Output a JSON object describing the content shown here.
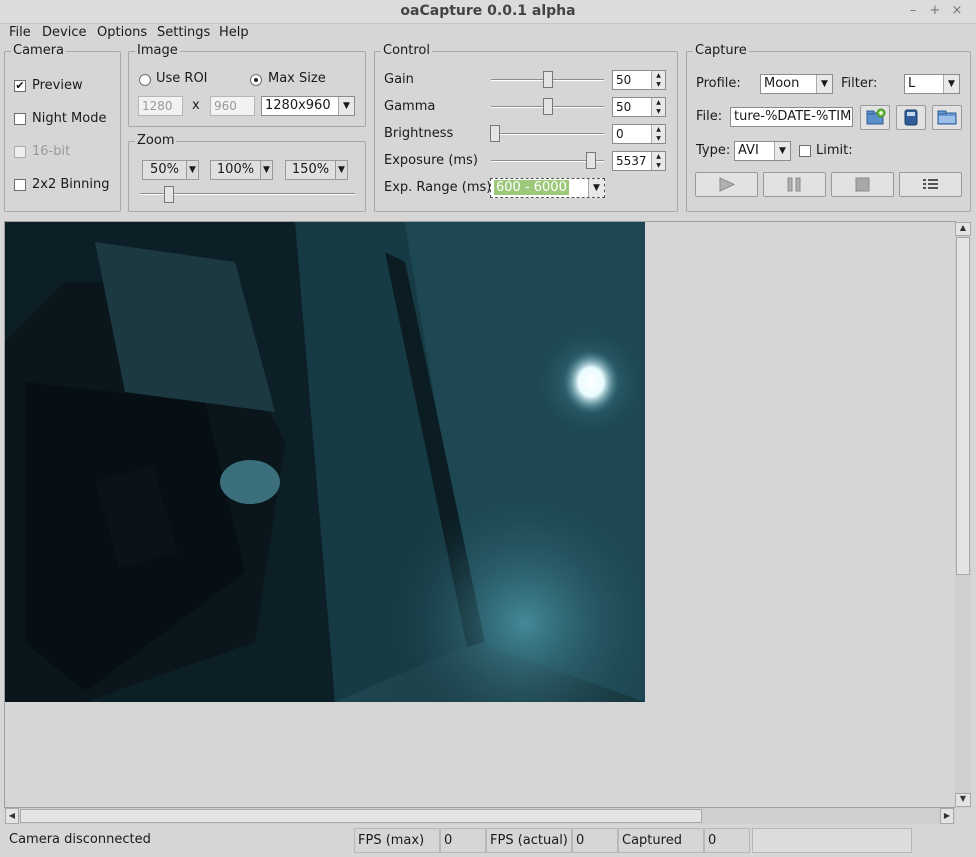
{
  "window": {
    "title": "oaCapture 0.0.1 alpha",
    "min": "–",
    "max": "+",
    "close": "×"
  },
  "menu": [
    "File",
    "Device",
    "Options",
    "Settings",
    "Help"
  ],
  "camera": {
    "title": "Camera",
    "preview": {
      "label": "Preview",
      "checked": true
    },
    "night_mode": {
      "label": "Night Mode",
      "checked": false
    },
    "bit16": {
      "label": "16-bit",
      "checked": false,
      "disabled": true
    },
    "binning": {
      "label": "2x2 Binning",
      "checked": false
    }
  },
  "image": {
    "title": "Image",
    "use_roi": "Use ROI",
    "max_size": "Max Size",
    "selected": "max_size",
    "width": "1280",
    "x": "x",
    "height": "960",
    "resolution": "1280x960"
  },
  "zoom": {
    "title": "Zoom",
    "buttons": [
      "50%",
      "100%",
      "150%"
    ],
    "level": 0.05
  },
  "control": {
    "title": "Control",
    "gain": {
      "label": "Gain",
      "value": "50",
      "level": 0.5
    },
    "gamma": {
      "label": "Gamma",
      "value": "50",
      "level": 0.5
    },
    "brightness": {
      "label": "Brightness",
      "value": "0",
      "level": 0.0
    },
    "exposure": {
      "label": "Exposure (ms)",
      "value": "5537",
      "level": 0.91
    },
    "exp_range": {
      "label": "Exp. Range (ms)",
      "value": "600 - 6000"
    }
  },
  "capture": {
    "title": "Capture",
    "profile_label": "Profile:",
    "profile": "Moon",
    "filter_label": "Filter:",
    "filter": "L",
    "file_label": "File:",
    "file": "ture-%DATE-%TIME",
    "type_label": "Type:",
    "type": "AVI",
    "limit_label": "Limit:",
    "limit_checked": false
  },
  "status": {
    "message": "Camera disconnected",
    "fps_max_label": "FPS (max)",
    "fps_max": "0",
    "fps_actual_label": "FPS (actual)",
    "fps_actual": "0",
    "captured_label": "Captured",
    "captured": "0"
  },
  "colors": {
    "selection": "#9dc87a",
    "window_bg": "#d6d6d6"
  }
}
